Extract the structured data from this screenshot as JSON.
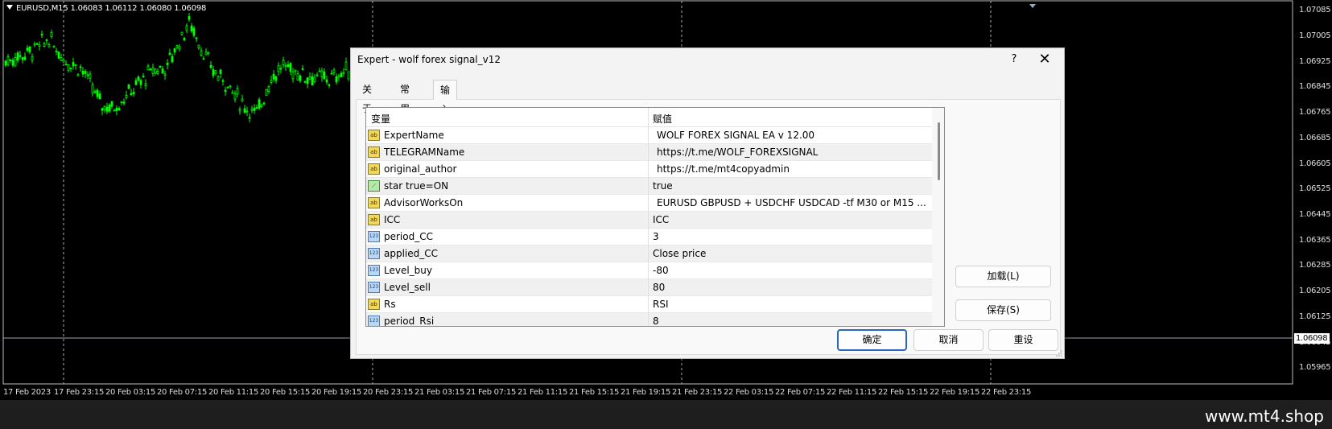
{
  "chart": {
    "symbol_info": "EURUSD,M15  1.06083 1.06112 1.06080 1.06098",
    "price_axis": [
      "1.07085",
      "1.07005",
      "1.06925",
      "1.06845",
      "1.06765",
      "1.06685",
      "1.06605",
      "1.06525",
      "1.06445",
      "1.06365",
      "1.06285",
      "1.06205",
      "1.06125",
      "1.06045",
      "1.05965"
    ],
    "current_price": "1.06098",
    "time_axis": [
      "17 Feb 2023",
      "17 Feb 23:15",
      "20 Feb 03:15",
      "20 Feb 07:15",
      "20 Feb 11:15",
      "20 Feb 15:15",
      "20 Feb 19:15",
      "20 Feb 23:15",
      "21 Feb 03:15",
      "21 Feb 07:15",
      "21 Feb 11:15",
      "21 Feb 15:15",
      "21 Feb 19:15",
      "21 Feb 23:15",
      "22 Feb 03:15",
      "22 Feb 07:15",
      "22 Feb 11:15",
      "22 Feb 15:15",
      "22 Feb 19:15",
      "22 Feb 23:15"
    ],
    "bar_color": "#00ff00",
    "background": "#000000"
  },
  "watermark": "www.mt4.shop",
  "dialog": {
    "title": "Expert - wolf forex signal_v12",
    "help_label": "?",
    "close_label": "✕",
    "tabs": [
      {
        "label": "关于"
      },
      {
        "label": "常用"
      },
      {
        "label": "输入参数"
      }
    ],
    "active_tab": "输入参数",
    "grid": {
      "headers": {
        "variable": "变量",
        "value": "赋值"
      },
      "rows": [
        {
          "icon": "ab",
          "type": "text",
          "name": "ExpertName",
          "value": "WOLF FOREX SIGNAL EA v 12.00"
        },
        {
          "icon": "ab",
          "type": "text",
          "name": "TELEGRAMName",
          "value": "https://t.me/WOLF_FOREXSIGNAL"
        },
        {
          "icon": "ab",
          "type": "text",
          "name": "original_author",
          "value": "https://t.me/mt4copyadmin"
        },
        {
          "icon": "⟋",
          "type": "bool",
          "name": "star true=ON",
          "value": "true"
        },
        {
          "icon": "ab",
          "type": "text",
          "name": "AdvisorWorksOn",
          "value": "EURUSD GBPUSD + USDCHF USDCAD  -tf M30 or M15 ..."
        },
        {
          "icon": "ab",
          "type": "text",
          "name": "ICC",
          "value": "ICC"
        },
        {
          "icon": "123",
          "type": "num",
          "name": "period_CC",
          "value": "3"
        },
        {
          "icon": "123",
          "type": "num",
          "name": "applied_CC",
          "value": "Close price"
        },
        {
          "icon": "123",
          "type": "num",
          "name": "Level_buy",
          "value": "-80"
        },
        {
          "icon": "123",
          "type": "num",
          "name": "Level_sell",
          "value": "80"
        },
        {
          "icon": "ab",
          "type": "text",
          "name": "Rs",
          "value": "RSI"
        },
        {
          "icon": "123",
          "type": "num",
          "name": "period_Rsi",
          "value": "8"
        }
      ]
    },
    "buttons": {
      "load": "加载(L)",
      "save": "保存(S)",
      "ok": "确定",
      "cancel": "取消",
      "reset": "重设"
    }
  }
}
